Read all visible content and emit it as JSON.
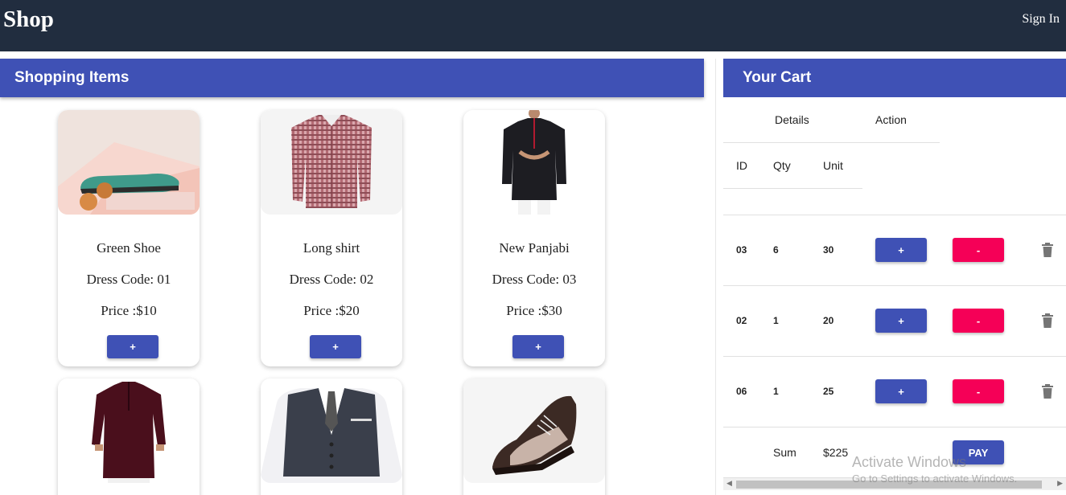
{
  "header": {
    "brand": "Shop",
    "sign_in": "Sign In"
  },
  "items_panel": {
    "title": "Shopping Items",
    "add_label": "+"
  },
  "products": [
    {
      "name": "Green Shoe",
      "code": "Dress Code: 01",
      "price": "Price :$10",
      "image": "green-shoe"
    },
    {
      "name": "Long shirt",
      "code": "Dress Code: 02",
      "price": "Price :$20",
      "image": "checked-shirt"
    },
    {
      "name": "New Panjabi",
      "code": "Dress Code: 03",
      "price": "Price :$30",
      "image": "black-panjabi"
    },
    {
      "name": "",
      "code": "",
      "price": "",
      "image": "maroon-panjabi"
    },
    {
      "name": "",
      "code": "",
      "price": "",
      "image": "waistcoat"
    },
    {
      "name": "",
      "code": "",
      "price": "",
      "image": "leather-shoe"
    }
  ],
  "cart": {
    "title": "Your Cart",
    "headers": {
      "details": "Details",
      "action": "Action",
      "id": "ID",
      "qty": "Qty",
      "unit": "Unit"
    },
    "rows": [
      {
        "id": "03",
        "qty": "6",
        "unit": "30"
      },
      {
        "id": "02",
        "qty": "1",
        "unit": "20"
      },
      {
        "id": "06",
        "qty": "1",
        "unit": "25"
      }
    ],
    "plus_label": "+",
    "minus_label": "-",
    "sum_label": "Sum",
    "sum_value": "$225",
    "pay_label": "PAY"
  },
  "watermark": {
    "line1": "Activate Windows",
    "line2": "Go to Settings to activate Windows."
  },
  "colors": {
    "navbar": "#212d3f",
    "primary": "#3f51b5",
    "accent": "#f50057"
  }
}
